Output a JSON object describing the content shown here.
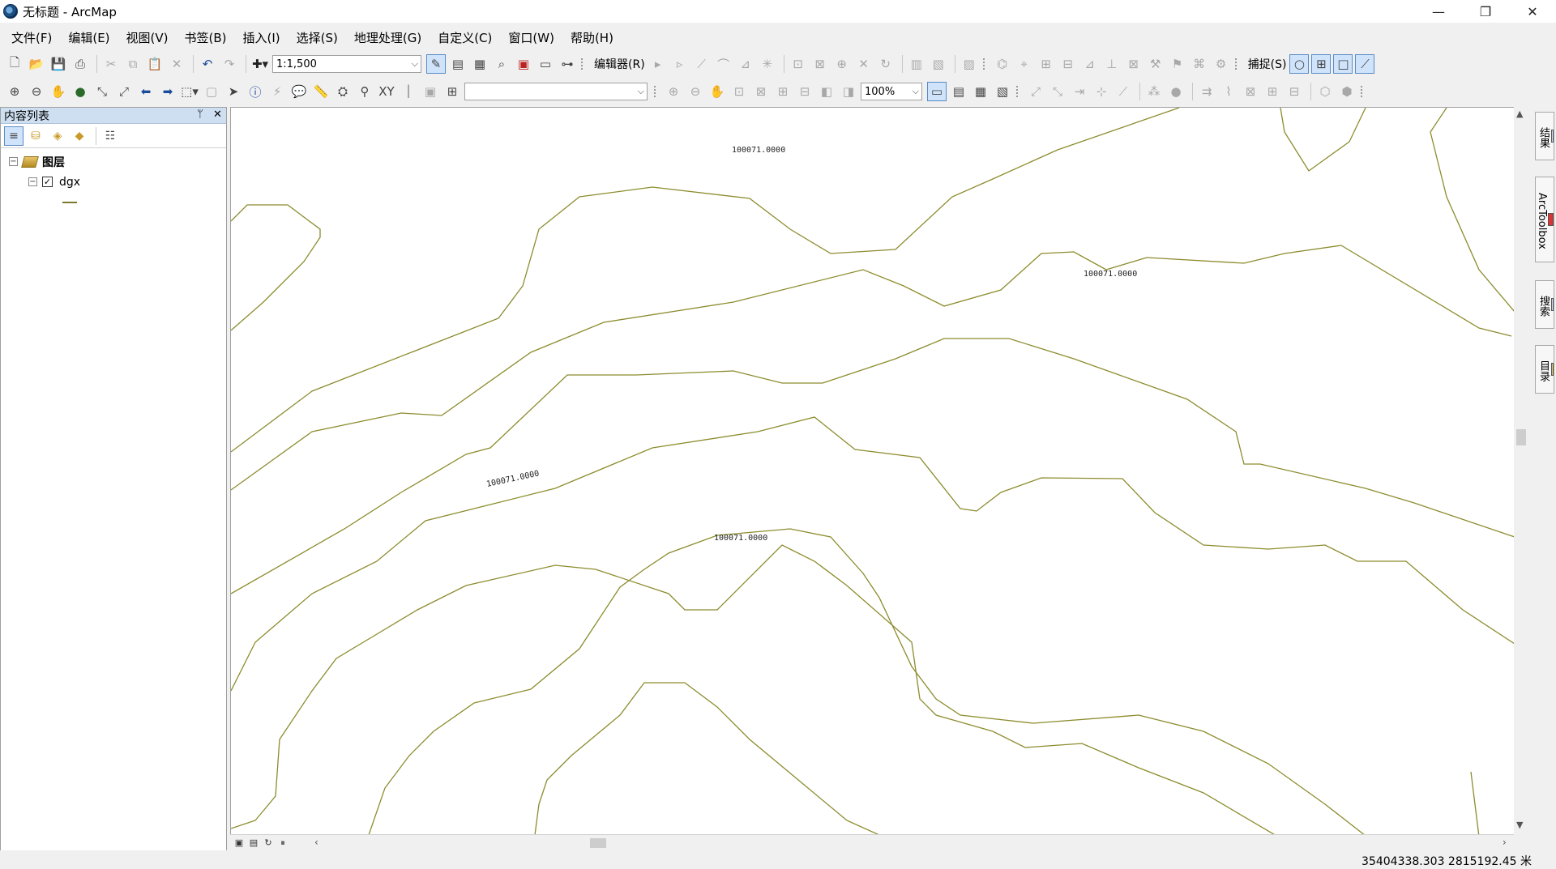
{
  "window": {
    "title": "无标题 - ArcMap"
  },
  "menu": [
    "文件(F)",
    "编辑(E)",
    "视图(V)",
    "书签(B)",
    "插入(I)",
    "选择(S)",
    "地理处理(G)",
    "自定义(C)",
    "窗口(W)",
    "帮助(H)"
  ],
  "toolbar": {
    "scale_value": "1:1,500",
    "editor_label": "编辑器(R)",
    "snapping_label": "捕捉(S)",
    "zoom_value": "100%",
    "layer_select_value": ""
  },
  "toc": {
    "title": "内容列表",
    "pin_glyph": "ᛘ",
    "close_glyph": "✕",
    "root_label": "图层",
    "layer_name": "dgx",
    "layer_checked": true
  },
  "map": {
    "contour_labels": [
      "100071.0000",
      "100071.0000",
      "100071.0000",
      "100071.0000"
    ],
    "line_color": "#8c8c2e"
  },
  "right_dock": [
    "结果",
    "ArcToolbox",
    "搜索",
    "目录"
  ],
  "status": {
    "coordinates": "35404338.303  2815192.45 米"
  }
}
